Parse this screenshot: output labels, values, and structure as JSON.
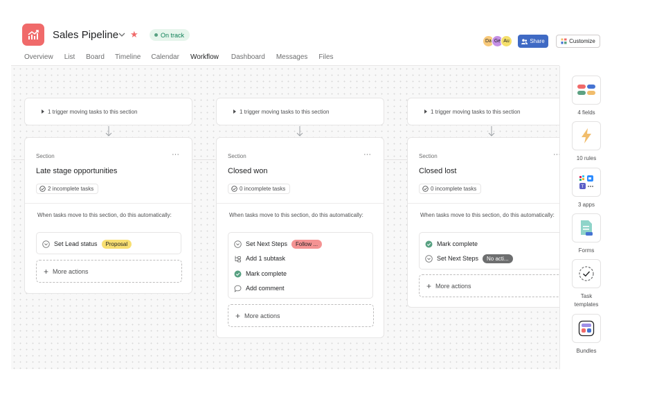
{
  "header": {
    "project_title": "Sales Pipeline",
    "status": "On track",
    "avatars": [
      {
        "initials": "Da",
        "color": "#f8c97a"
      },
      {
        "initials": "Ge",
        "color": "#c48fe5"
      },
      {
        "initials": "Au",
        "color": "#f5df6b"
      }
    ],
    "share_label": "Share",
    "customize_label": "Customize"
  },
  "tabs": [
    "Overview",
    "List",
    "Board",
    "Timeline",
    "Calendar",
    "Workflow",
    "Dashboard",
    "Messages",
    "Files"
  ],
  "active_tab": "Workflow",
  "sections": [
    {
      "trigger": "1 trigger moving tasks to this section",
      "eyebrow": "Section",
      "name": "Late stage opportunities",
      "incomplete": "2 incomplete tasks",
      "auto_text": "When tasks move to this section, do this automatically:",
      "actions": [
        {
          "icon": "circle-chevron-icon",
          "label": "Set Lead status",
          "pill": "Proposal",
          "pill_style": "yellow"
        }
      ],
      "more_actions": "More actions"
    },
    {
      "trigger": "1 trigger moving tasks to this section",
      "eyebrow": "Section",
      "name": "Closed won",
      "incomplete": "0 incomplete tasks",
      "auto_text": "When tasks move to this section, do this automatically:",
      "actions": [
        {
          "icon": "circle-chevron-icon",
          "label": "Set Next Steps",
          "pill": "Follow ...",
          "pill_style": "pink"
        },
        {
          "icon": "subtask-icon",
          "label": "Add 1 subtask"
        },
        {
          "icon": "check-circle-icon",
          "label": "Mark complete"
        },
        {
          "icon": "comment-icon",
          "label": "Add comment"
        }
      ],
      "more_actions": "More actions"
    },
    {
      "trigger": "1 trigger moving tasks to this section",
      "eyebrow": "Section",
      "name": "Closed lost",
      "incomplete": "0 incomplete tasks",
      "auto_text": "When tasks move to this section, do this automatically:",
      "actions": [
        {
          "icon": "check-circle-icon",
          "label": "Mark complete"
        },
        {
          "icon": "circle-chevron-icon",
          "label": "Set Next Steps",
          "pill": "No acti...",
          "pill_style": "dark"
        }
      ],
      "more_actions": "More actions"
    }
  ],
  "rail": [
    {
      "icon": "fields-icon",
      "label": "4 fields"
    },
    {
      "icon": "lightning-icon",
      "label": "10 rules"
    },
    {
      "icon": "apps-icon",
      "label": "3 apps"
    },
    {
      "icon": "form-icon",
      "label": "Forms"
    },
    {
      "icon": "task-template-icon",
      "label": "Task templates"
    },
    {
      "icon": "bundles-icon",
      "label": "Bundles"
    }
  ],
  "colors": {
    "logo": "#f06a6a",
    "share": "#3f6ac4",
    "status_green": "#58a182",
    "check_green": "#58a182"
  }
}
